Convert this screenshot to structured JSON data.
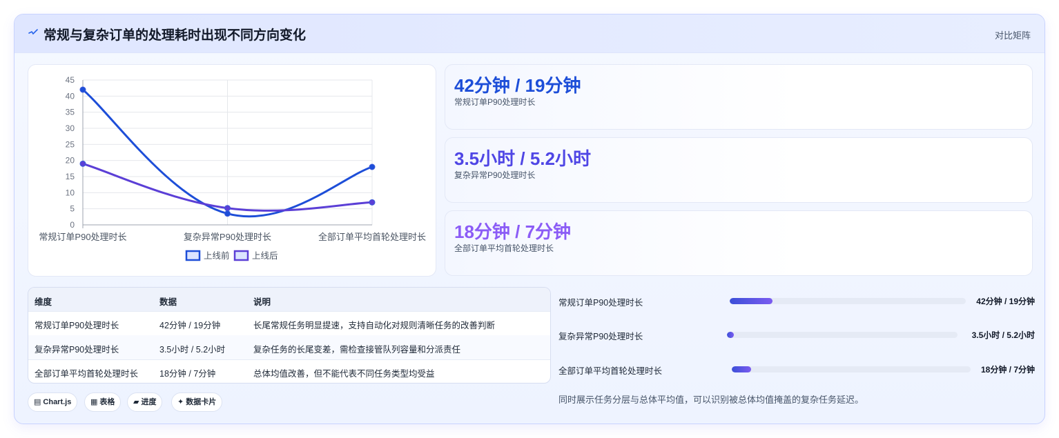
{
  "header": {
    "title": "常规与复杂订单的处理耗时出现不同方向变化",
    "tag": "对比矩阵"
  },
  "chart_data": {
    "type": "line",
    "categories": [
      "常规订单P90处理时长",
      "复杂异常P90处理时长",
      "全部订单平均首轮处理时长"
    ],
    "series": [
      {
        "name": "上线前",
        "values": [
          42,
          3.5,
          18
        ],
        "color": "#1d4ed8"
      },
      {
        "name": "上线后",
        "values": [
          19,
          5.2,
          7
        ],
        "color": "#5b3fd6"
      }
    ],
    "yticks": [
      "0",
      "5",
      "10",
      "15",
      "20",
      "25",
      "30",
      "35",
      "40",
      "45"
    ],
    "ylim": [
      0,
      45
    ],
    "grid": true,
    "legend": "bottom"
  },
  "kpis": [
    {
      "value": "42分钟 / 19分钟",
      "label": "常规订单P90处理时长",
      "color": "#1d4ed8"
    },
    {
      "value": "3.5小时 / 5.2小时",
      "label": "复杂异常P90处理时长",
      "color": "#4f46e5"
    },
    {
      "value": "18分钟 / 7分钟",
      "label": "全部订单平均首轮处理时长",
      "color": "#8b5cf6"
    }
  ],
  "table": {
    "headers": [
      "维度",
      "数据",
      "说明"
    ],
    "rows": [
      [
        "常规订单P90处理时长",
        "42分钟 / 19分钟",
        "长尾常规任务明显提速，支持自动化对规则清晰任务的改善判断"
      ],
      [
        "复杂异常P90处理时长",
        "3.5小时 / 5.2小时",
        "复杂任务的长尾变差，需检查接管队列容量和分派责任"
      ],
      [
        "全部订单平均首轮处理时长",
        "18分钟 / 7分钟",
        "总体均值改善，但不能代表不同任务类型均受益"
      ]
    ]
  },
  "chips": [
    {
      "icon": "▤",
      "label": "Chart.js"
    },
    {
      "icon": "▦",
      "label": "表格"
    },
    {
      "icon": "▰",
      "label": "进度"
    },
    {
      "icon": "✦",
      "label": "数据卡片"
    }
  ],
  "progress": [
    {
      "label": "常规订单P90处理时长",
      "value": "42分钟 / 19分钟",
      "fraction": 0.18
    },
    {
      "label": "复杂异常P90处理时长",
      "value": "3.5小时 / 5.2小时",
      "fraction": 0.03
    },
    {
      "label": "全部订单平均首轮处理时长",
      "value": "18分钟 / 7分钟",
      "fraction": 0.08
    }
  ],
  "note": "同时展示任务分层与总体平均值，可以识别被总体均值掩盖的复杂任务延迟。"
}
